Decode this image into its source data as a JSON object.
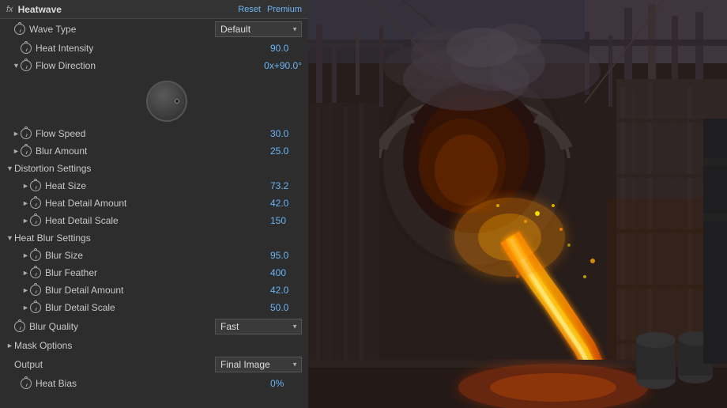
{
  "header": {
    "fx_label": "fx",
    "plugin_name": "Heatwave",
    "reset_label": "Reset",
    "premium_label": "Premium"
  },
  "params": {
    "wave_type": {
      "label": "Wave Type",
      "value": "Default"
    },
    "heat_intensity": {
      "label": "Heat Intensity",
      "value": "90.0"
    },
    "flow_direction": {
      "label": "Flow Direction",
      "value": "0x+90.0°"
    },
    "flow_speed": {
      "label": "Flow Speed",
      "value": "30.0"
    },
    "blur_amount": {
      "label": "Blur Amount",
      "value": "25.0"
    },
    "distortion_settings": {
      "label": "Distortion Settings"
    },
    "heat_size": {
      "label": "Heat Size",
      "value": "73.2"
    },
    "heat_detail_amount": {
      "label": "Heat Detail Amount",
      "value": "42.0"
    },
    "heat_detail_scale": {
      "label": "Heat Detail Scale",
      "value": "150"
    },
    "heat_blur_settings": {
      "label": "Heat Blur Settings"
    },
    "blur_size": {
      "label": "Blur Size",
      "value": "95.0"
    },
    "blur_feather": {
      "label": "Blur Feather",
      "value": "400"
    },
    "blur_detail_amount": {
      "label": "Blur Detail Amount",
      "value": "42.0"
    },
    "blur_detail_scale": {
      "label": "Blur Detail Scale",
      "value": "50.0"
    },
    "blur_quality": {
      "label": "Blur Quality",
      "value": "Fast"
    },
    "mask_options": {
      "label": "Mask Options"
    },
    "output": {
      "label": "Output",
      "value": "Final Image"
    },
    "heat_bias": {
      "label": "Heat Bias",
      "value": "0%"
    }
  },
  "icons": {
    "expand": "▼",
    "collapse": "►"
  }
}
